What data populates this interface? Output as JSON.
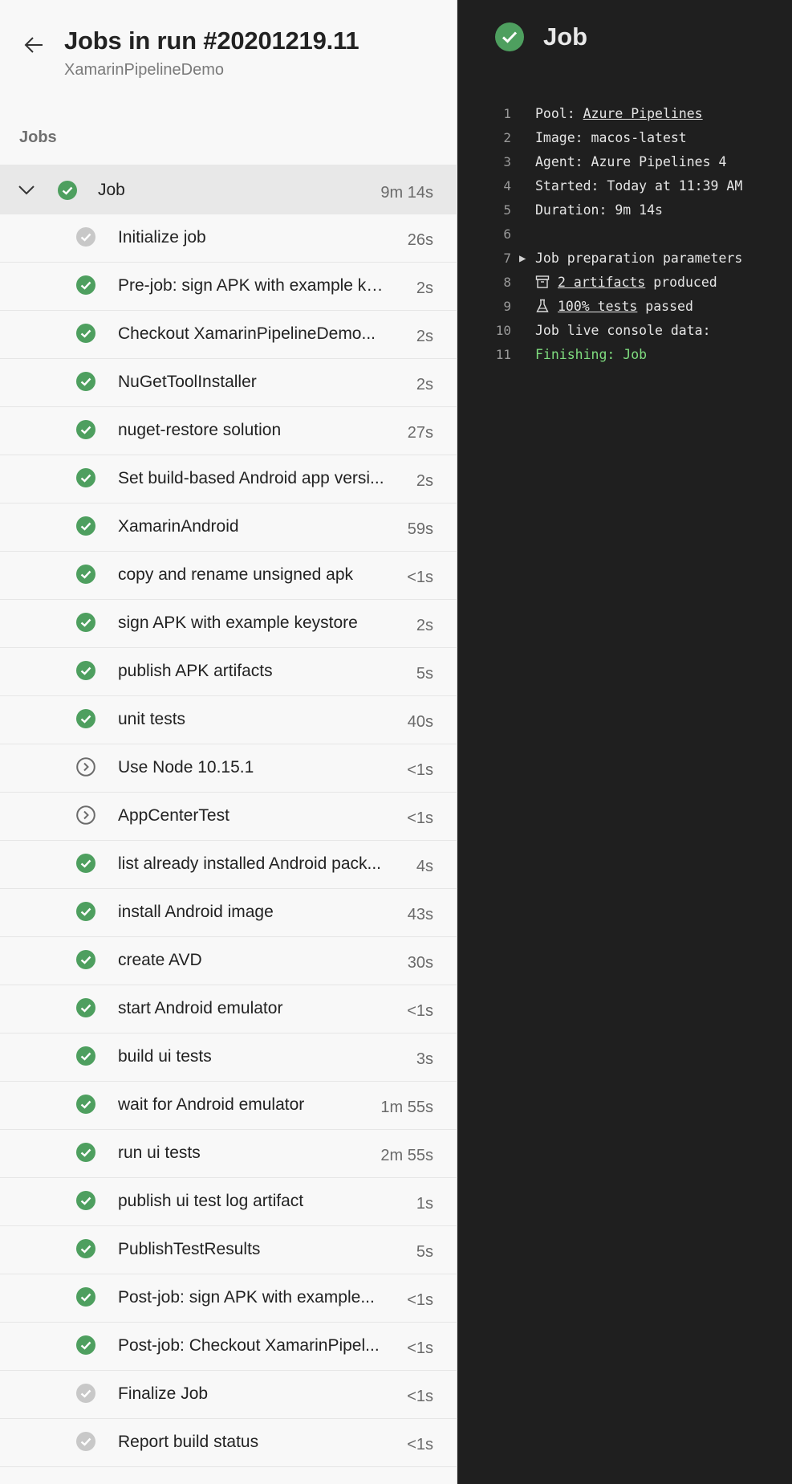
{
  "header": {
    "title": "Jobs in run #20201219.11",
    "subtitle": "XamarinPipelineDemo"
  },
  "section_label": "Jobs",
  "job": {
    "name": "Job",
    "duration": "9m 14s",
    "status": "succeeded"
  },
  "steps": [
    {
      "name": "Initialize job",
      "duration": "26s",
      "status": "grey"
    },
    {
      "name": "Pre-job: sign APK with example ke...",
      "duration": "2s",
      "status": "success"
    },
    {
      "name": "Checkout XamarinPipelineDemo...",
      "duration": "2s",
      "status": "success"
    },
    {
      "name": "NuGetToolInstaller",
      "duration": "2s",
      "status": "success"
    },
    {
      "name": "nuget-restore solution",
      "duration": "27s",
      "status": "success"
    },
    {
      "name": "Set build-based Android app versi...",
      "duration": "2s",
      "status": "success"
    },
    {
      "name": "XamarinAndroid",
      "duration": "59s",
      "status": "success"
    },
    {
      "name": "copy and rename unsigned apk",
      "duration": "<1s",
      "status": "success"
    },
    {
      "name": "sign APK with example keystore",
      "duration": "2s",
      "status": "success"
    },
    {
      "name": "publish APK artifacts",
      "duration": "5s",
      "status": "success"
    },
    {
      "name": "unit tests",
      "duration": "40s",
      "status": "success"
    },
    {
      "name": "Use Node 10.15.1",
      "duration": "<1s",
      "status": "skipped"
    },
    {
      "name": "AppCenterTest",
      "duration": "<1s",
      "status": "skipped"
    },
    {
      "name": "list already installed Android pack...",
      "duration": "4s",
      "status": "success"
    },
    {
      "name": "install Android image",
      "duration": "43s",
      "status": "success"
    },
    {
      "name": "create AVD",
      "duration": "30s",
      "status": "success"
    },
    {
      "name": "start Android emulator",
      "duration": "<1s",
      "status": "success"
    },
    {
      "name": "build ui tests",
      "duration": "3s",
      "status": "success"
    },
    {
      "name": "wait for Android emulator",
      "duration": "1m 55s",
      "status": "success"
    },
    {
      "name": "run ui tests",
      "duration": "2m 55s",
      "status": "success"
    },
    {
      "name": "publish ui test log artifact",
      "duration": "1s",
      "status": "success"
    },
    {
      "name": "PublishTestResults",
      "duration": "5s",
      "status": "success"
    },
    {
      "name": "Post-job: sign APK with example...",
      "duration": "<1s",
      "status": "success"
    },
    {
      "name": "Post-job: Checkout XamarinPipel...",
      "duration": "<1s",
      "status": "success"
    },
    {
      "name": "Finalize Job",
      "duration": "<1s",
      "status": "grey"
    },
    {
      "name": "Report build status",
      "duration": "<1s",
      "status": "grey"
    }
  ],
  "detail": {
    "title": "Job",
    "log": {
      "pool_label": "Pool: ",
      "pool_value": "Azure Pipelines",
      "image": "Image: macos-latest",
      "agent": "Agent: Azure Pipelines 4",
      "started": "Started: Today at 11:39 AM",
      "duration": "Duration: 9m 14s",
      "prep_params": "Job preparation parameters",
      "artifacts_link": "2 artifacts",
      "artifacts_suffix": " produced",
      "tests_link": "100% tests",
      "tests_suffix": " passed",
      "console": "Job live console data:",
      "finishing": "Finishing: Job"
    },
    "line_numbers": [
      "1",
      "2",
      "3",
      "4",
      "5",
      "6",
      "7",
      "8",
      "9",
      "10",
      "11"
    ]
  },
  "colors": {
    "success": "#4e9f5f",
    "grey": "#c2c2c2",
    "skipped": "#6b6b6b",
    "console_bg": "#1f1f1f",
    "finishing_green": "#7fdc7f"
  },
  "icons": {
    "back": "arrow-left-icon",
    "collapse": "chevron-down-icon",
    "success": "check-circle-icon",
    "grey": "check-circle-grey-icon",
    "skipped": "skip-circle-icon",
    "expand": "triangle-right-icon",
    "artifact": "archive-icon",
    "test": "flask-icon"
  }
}
